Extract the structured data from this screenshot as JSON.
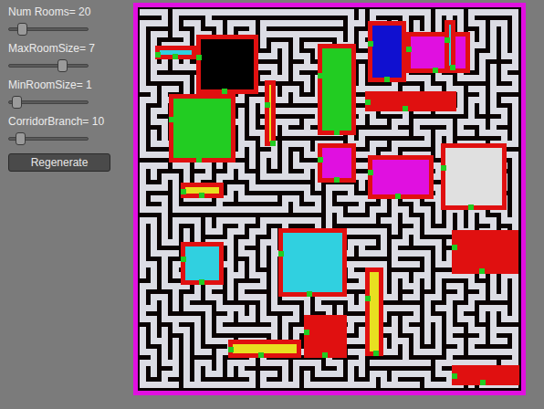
{
  "controls": {
    "sliders": [
      {
        "label": "Num Rooms= 20",
        "level": 0.13
      },
      {
        "label": "MaxRoomSize= 7",
        "level": 0.7
      },
      {
        "label": "MinRoomSize= 1",
        "level": 0.05
      },
      {
        "label": "CorridorBranch= 10",
        "level": 0.1
      }
    ],
    "button": "Regenerate"
  },
  "map": {
    "rooms": [
      {
        "color": "#000000"
      },
      {
        "color": "#22cc22"
      },
      {
        "color": "#22cc22"
      },
      {
        "color": "#1010d0"
      },
      {
        "color": "#e010e0"
      },
      {
        "color": "#e01010"
      },
      {
        "color": "#e010e0"
      },
      {
        "color": "#e010e0"
      },
      {
        "color": "#e0e0e0"
      },
      {
        "color": "#e01010"
      },
      {
        "color": "#30d0e0"
      },
      {
        "color": "#30d0e0"
      },
      {
        "color": "#e8e020"
      },
      {
        "color": "#e8e020"
      },
      {
        "color": "#e01010"
      },
      {
        "color": "#e8e020"
      },
      {
        "color": "#e01010"
      },
      {
        "color": "#e8e020"
      },
      {
        "color": "#30d0e0"
      },
      {
        "color": "#30d0e0"
      }
    ]
  }
}
